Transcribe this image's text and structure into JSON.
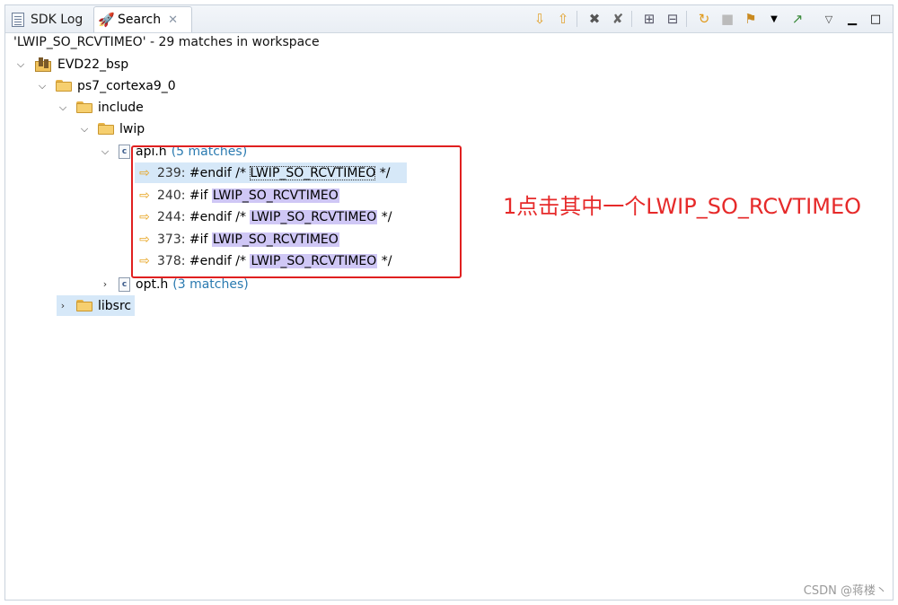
{
  "tabs": [
    {
      "label": "SDK Log",
      "icon": "log-icon"
    },
    {
      "label": "Search",
      "icon": "search-icon",
      "close": "✕"
    }
  ],
  "toolbar": {
    "icons": [
      "next-match-icon",
      "previous-match-icon",
      "remove-selected-icon",
      "remove-all-icon",
      "expand-all-icon",
      "collapse-all-icon",
      "rerun-search-icon",
      "cancel-search-icon",
      "search-history-icon",
      "dropdown-arrow-icon",
      "pin-icon",
      "view-menu-icon",
      "minimize-icon",
      "maximize-icon"
    ]
  },
  "status": "'LWIP_SO_RCVTIMEO' - 29 matches in workspace",
  "tree": {
    "project": "EVD22_bsp",
    "folder1": "ps7_cortexa9_0",
    "folder2": "include",
    "folder3": "lwip",
    "file1": {
      "name": "api.h",
      "count": "(5 matches)"
    },
    "matches": [
      {
        "line": "239:",
        "pre": "#endif /*",
        "term": "LWIP_SO_RCVTIMEO",
        "post": "*/"
      },
      {
        "line": "240:",
        "pre": "#if",
        "term": "LWIP_SO_RCVTIMEO",
        "post": ""
      },
      {
        "line": "244:",
        "pre": "#endif /*",
        "term": "LWIP_SO_RCVTIMEO",
        "post": "*/"
      },
      {
        "line": "373:",
        "pre": "#if",
        "term": "LWIP_SO_RCVTIMEO",
        "post": ""
      },
      {
        "line": "378:",
        "pre": "#endif /*",
        "term": "LWIP_SO_RCVTIMEO",
        "post": "*/"
      }
    ],
    "file2": {
      "name": "opt.h",
      "count": "(3 matches)"
    },
    "folder4": "libsrc"
  },
  "annotation": "1点击其中一个LWIP_SO_RCVTIMEO",
  "watermark": "CSDN @蒋楼丶",
  "colors": {
    "annotation": "#e62a2a",
    "highlight": "#cfc7f5",
    "selection": "#d6e8f8"
  }
}
